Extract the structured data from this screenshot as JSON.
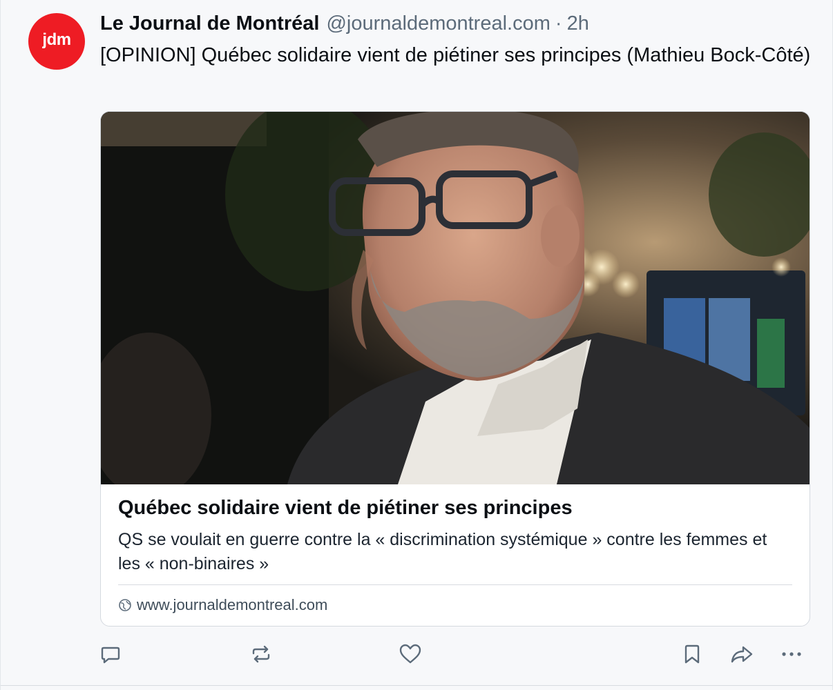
{
  "post": {
    "avatar_text": "jdm",
    "display_name": "Le Journal de Montréal",
    "handle": "@journaldemontreal.com",
    "separator": "·",
    "time": "2h",
    "text": "[OPINION] Québec solidaire vient de piétiner ses principes (Mathieu Bock-Côté)"
  },
  "card": {
    "title": "Québec solidaire vient de piétiner ses principes",
    "description": "QS se voulait en guerre contre la « discrimination systémique » contre les femmes et les « non-binaires »",
    "domain": "www.journaldemontreal.com"
  },
  "actions": [
    "reply-icon",
    "repost-icon",
    "like-icon",
    "bookmark-icon",
    "share-icon",
    "more-icon"
  ],
  "colors": {
    "avatar_bg": "#ee1c24",
    "icon": "#5c6b7a",
    "text": "#0b0f14",
    "muted": "#5c6b7a"
  }
}
